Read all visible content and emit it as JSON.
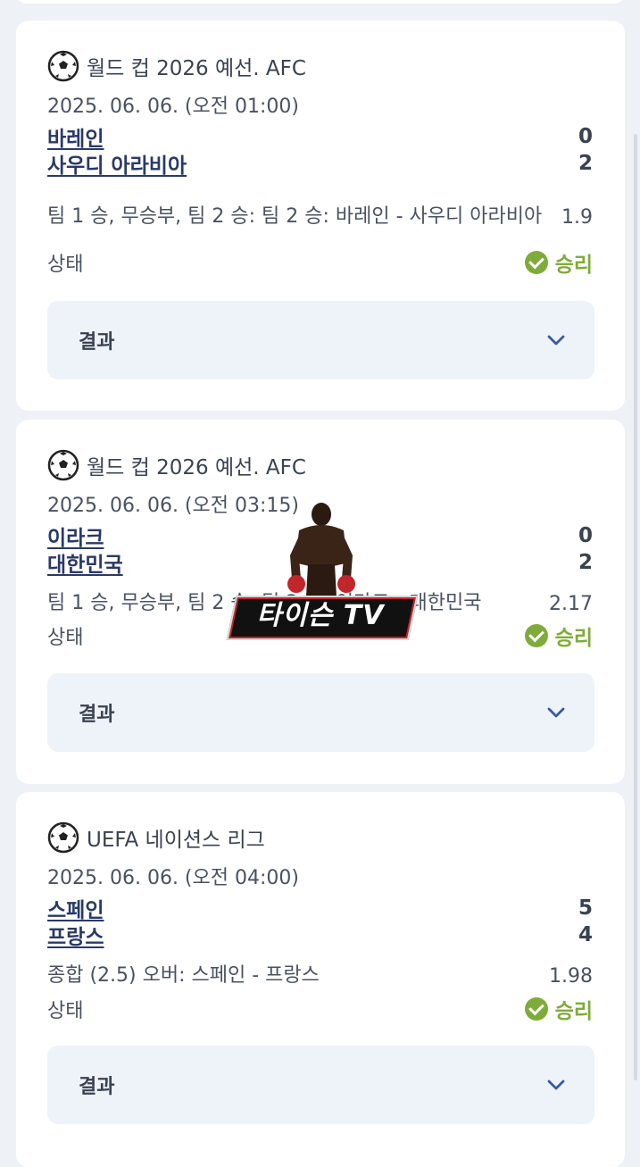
{
  "cards": [
    {
      "league": "월드 컵 2026 예선. AFC",
      "date": "2025. 06. 06. (오전 01:00)",
      "team1": "바레인",
      "team2": "사우디 아라비아",
      "score1": "0",
      "score2": "2",
      "bet": "팀 1 승, 무승부, 팀 2 승: 팀 2 승: 바레인 - 사우디 아라비아",
      "odds": "1.9",
      "status_label": "상태",
      "status": "승리",
      "result_label": "결과"
    },
    {
      "league": "월드 컵 2026 예선. AFC",
      "date": "2025. 06. 06. (오전 03:15)",
      "team1": "이라크",
      "team2": "대한민국",
      "score1": "0",
      "score2": "2",
      "bet": "팀 1 승, 무승부, 팀 2 승: 팀 2 승: 이라크 - 대한민국",
      "odds": "2.17",
      "status_label": "상태",
      "status": "승리",
      "result_label": "결과"
    },
    {
      "league": "UEFA 네이션스 리그",
      "date": "2025. 06. 06. (오전 04:00)",
      "team1": "스페인",
      "team2": "프랑스",
      "score1": "5",
      "score2": "4",
      "bet": "종합 (2.5) 오버: 스페인 - 프랑스",
      "odds": "1.98",
      "status_label": "상태",
      "status": "승리",
      "result_label": "결과"
    }
  ],
  "watermark": {
    "text": "타이슨 TV"
  },
  "colors": {
    "win": "#7fab3a",
    "team_link": "#2a3a66",
    "background": "#eef1f6",
    "result_box": "#eef2f9"
  },
  "icons": {
    "league": "soccer-ball-icon",
    "status": "check-circle-icon",
    "expand": "chevron-down-icon"
  }
}
